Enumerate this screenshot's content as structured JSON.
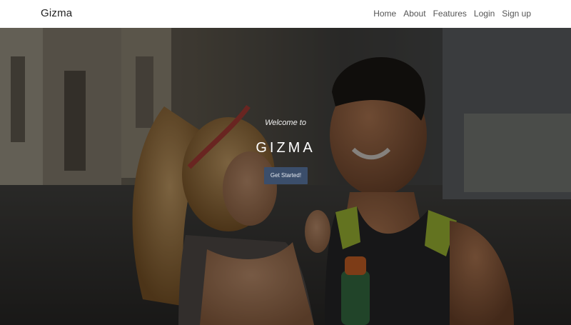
{
  "header": {
    "brand": "Gizma",
    "nav": [
      {
        "label": "Home"
      },
      {
        "label": "About"
      },
      {
        "label": "Features"
      },
      {
        "label": "Login"
      },
      {
        "label": "Sign up"
      }
    ]
  },
  "hero": {
    "welcome": "Welcome to",
    "title": "GIZMA",
    "cta_label": "Get Started!"
  },
  "colors": {
    "navbar_bg": "#ffffff",
    "cta_bg": "#3b4e6b",
    "overlay": "#000000"
  },
  "icons": {
    "photo": "hero-photo-image"
  }
}
